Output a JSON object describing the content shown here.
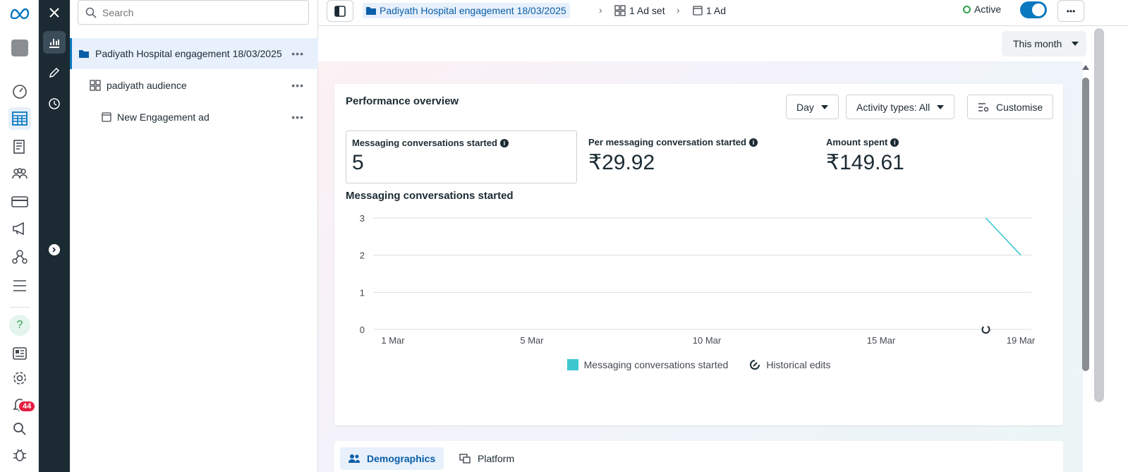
{
  "search": {
    "placeholder": "Search"
  },
  "tree": {
    "items": [
      {
        "label": "Padiyath Hospital engagement 18/03/2025",
        "type": "campaign"
      },
      {
        "label": "padiyath audience",
        "type": "adset"
      },
      {
        "label": "New Engagement ad",
        "type": "ad"
      }
    ],
    "more": "•••"
  },
  "breadcrumb": {
    "campaign": "Padiyath Hospital engagement 18/03/2025",
    "adset": "1 Ad set",
    "ad": "1 Ad"
  },
  "status": {
    "label": "Active",
    "toggle_on": true
  },
  "topbar": {
    "more": "•••"
  },
  "date_range": "This month",
  "overview": {
    "title": "Performance overview",
    "granularity": "Day",
    "activity": "Activity types: All",
    "customise": "Customise",
    "metrics": [
      {
        "label": "Messaging conversations started",
        "value": "5"
      },
      {
        "label": "Per messaging conversation started",
        "value": "₹29.92"
      },
      {
        "label": "Amount spent",
        "value": "₹149.61"
      }
    ],
    "chart_title": "Messaging conversations started"
  },
  "chart_data": {
    "type": "line",
    "x_tick_labels": [
      "1 Mar",
      "5 Mar",
      "10 Mar",
      "15 Mar",
      "19 Mar"
    ],
    "ylim": [
      0,
      3
    ],
    "y_ticks": [
      0,
      1,
      2,
      3
    ],
    "grid": true,
    "series": [
      {
        "name": "Messaging conversations started",
        "color": "#3ec7cf",
        "points": [
          {
            "x": "18 Mar",
            "y": 3
          },
          {
            "x": "19 Mar",
            "y": 2
          }
        ]
      }
    ],
    "annotations": [
      {
        "x": "18 Mar",
        "type": "Historical edits"
      }
    ],
    "legend": [
      "Messaging conversations started",
      "Historical edits"
    ],
    "legend_position": "bottom"
  },
  "tabs": [
    "Demographics",
    "Platform"
  ],
  "notifications": {
    "count": "44"
  },
  "colors": {
    "accent": "#0a78be",
    "line": "#3ec7cf",
    "dark_rail": "#1c2b33",
    "badge": "#e41e3f"
  }
}
